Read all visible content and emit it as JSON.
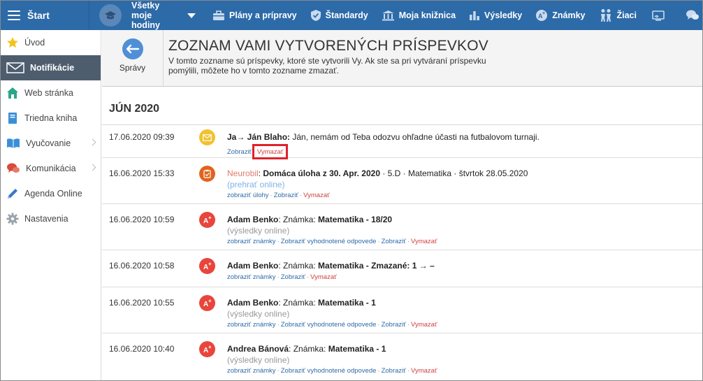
{
  "topbar": {
    "start_label": "Štart",
    "hours_label_1": "Všetky",
    "hours_label_2": "moje hodiny",
    "items": [
      {
        "label": "Plány a prípravy",
        "icon": "briefcase-icon"
      },
      {
        "label": "Štandardy",
        "icon": "shield-check-icon"
      },
      {
        "label": "Moja knižnica",
        "icon": "library-icon"
      },
      {
        "label": "Výsledky",
        "icon": "bar-chart-icon"
      },
      {
        "label": "Známky",
        "icon": "grade-icon"
      },
      {
        "label": "Žiaci",
        "icon": "students-icon"
      }
    ]
  },
  "sidebar": {
    "items": [
      {
        "label": "Úvod",
        "icon": "star-icon"
      },
      {
        "label": "Notifikácie",
        "icon": "envelope-icon",
        "active": true
      },
      {
        "label": "Web stránka",
        "icon": "home-icon"
      },
      {
        "label": "Triedna kniha",
        "icon": "book-icon"
      },
      {
        "label": "Vyučovanie",
        "icon": "open-book-icon",
        "chevron": true
      },
      {
        "label": "Komunikácia",
        "icon": "chat-bubbles-icon",
        "chevron": true
      },
      {
        "label": "Agenda Online",
        "icon": "pencil-icon"
      },
      {
        "label": "Nastavenia",
        "icon": "gear-icon"
      }
    ]
  },
  "header": {
    "back_label": "Správy",
    "title": "ZOZNAM VAMI VYTVORENÝCH PRÍSPEVKOV",
    "description": "V tomto zozname sú príspevky, ktoré ste vytvorili Vy. Ak ste sa pri vytváraní príspevku pomýlili, môžete ho v tomto zozname zmazať."
  },
  "month": "JÚN 2020",
  "entries": [
    {
      "datetime": "17.06.2020 09:39",
      "icon": "envelope-icon",
      "icon_color": "#f2c12e",
      "sender": "Ja→ Ján Blaho:",
      "text": " Ján, nemám od Teba odozvu ohľadne účasti na futbalovom turnaji.",
      "actions": [
        "Zobraziť",
        "Vymazať"
      ]
    },
    {
      "datetime": "16.06.2020 15:33",
      "icon": "clipboard-icon",
      "icon_color": "#e0641e",
      "sender": "Neurobil",
      "text_bold": "Domáca úloha z 30. Apr. 2020",
      "text_rest": " · 5.D · Matematika · štvrtok 28.05.2020",
      "sub": "(prehrať online)",
      "actions": [
        "zobraziť úlohy",
        "Zobraziť",
        "Vymazať"
      ]
    },
    {
      "datetime": "16.06.2020 10:59",
      "icon": "grade-icon",
      "icon_color": "#e8453c",
      "sender": "Adam Benko",
      "label": ": Známka: ",
      "value": "Matematika - 18/20",
      "sub": "(výsledky online)",
      "actions": [
        "zobraziť známky",
        "Zobraziť vyhodnotené odpovede",
        "Zobraziť",
        "Vymazať"
      ]
    },
    {
      "datetime": "16.06.2020 10:58",
      "icon": "grade-icon",
      "icon_color": "#e8453c",
      "sender": "Adam Benko",
      "label": ": Známka: ",
      "value": "Matematika - Zmazané: 1 → –",
      "actions": [
        "zobraziť známky",
        "Zobraziť",
        "Vymazať"
      ]
    },
    {
      "datetime": "16.06.2020 10:55",
      "icon": "grade-icon",
      "icon_color": "#e8453c",
      "sender": "Adam Benko",
      "label": ": Známka: ",
      "value": "Matematika - 1",
      "sub": "(výsledky online)",
      "actions": [
        "zobraziť známky",
        "Zobraziť vyhodnotené odpovede",
        "Zobraziť",
        "Vymazať"
      ]
    },
    {
      "datetime": "16.06.2020 10:40",
      "icon": "grade-icon",
      "icon_color": "#e8453c",
      "sender": "Andrea Bánová",
      "label": ": Známka: ",
      "value": "Matematika - 1",
      "sub": "(výsledky online)",
      "actions": [
        "zobraziť známky",
        "Zobraziť vyhodnotené odpovede",
        "Zobraziť",
        "Vymazať"
      ]
    }
  ],
  "colors": {
    "topbar": "#2d6aa8",
    "sidebar_active": "#4d5d6e",
    "link": "#2d6aa8",
    "delete": "#d04040",
    "highlight": "#e0212b"
  }
}
